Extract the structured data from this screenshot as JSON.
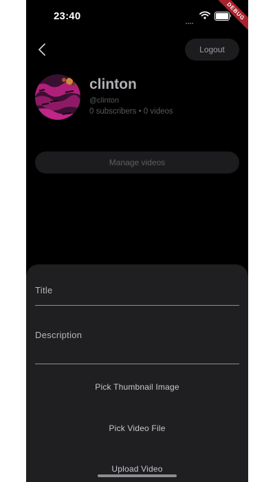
{
  "status_bar": {
    "time": "23:40",
    "debug_banner": "DEBUG"
  },
  "header": {
    "back_icon": "chevron-left-icon",
    "logout_label": "Logout"
  },
  "profile": {
    "name": "clinton",
    "handle": "@clinton",
    "stats": "0 subscribers • 0 videos"
  },
  "manage_videos_label": "Manage videos",
  "upload_sheet": {
    "title_placeholder": "Title",
    "title_value": "",
    "description_placeholder": "Description",
    "description_value": "",
    "pick_thumbnail_label": "Pick Thumbnail Image",
    "pick_video_label": "Pick Video File",
    "upload_label": "Upload Video"
  },
  "colors": {
    "background": "#000000",
    "sheet": "#1f1e21",
    "pill_button": "#1c1c1e",
    "debug_ribbon": "#a8232b"
  }
}
